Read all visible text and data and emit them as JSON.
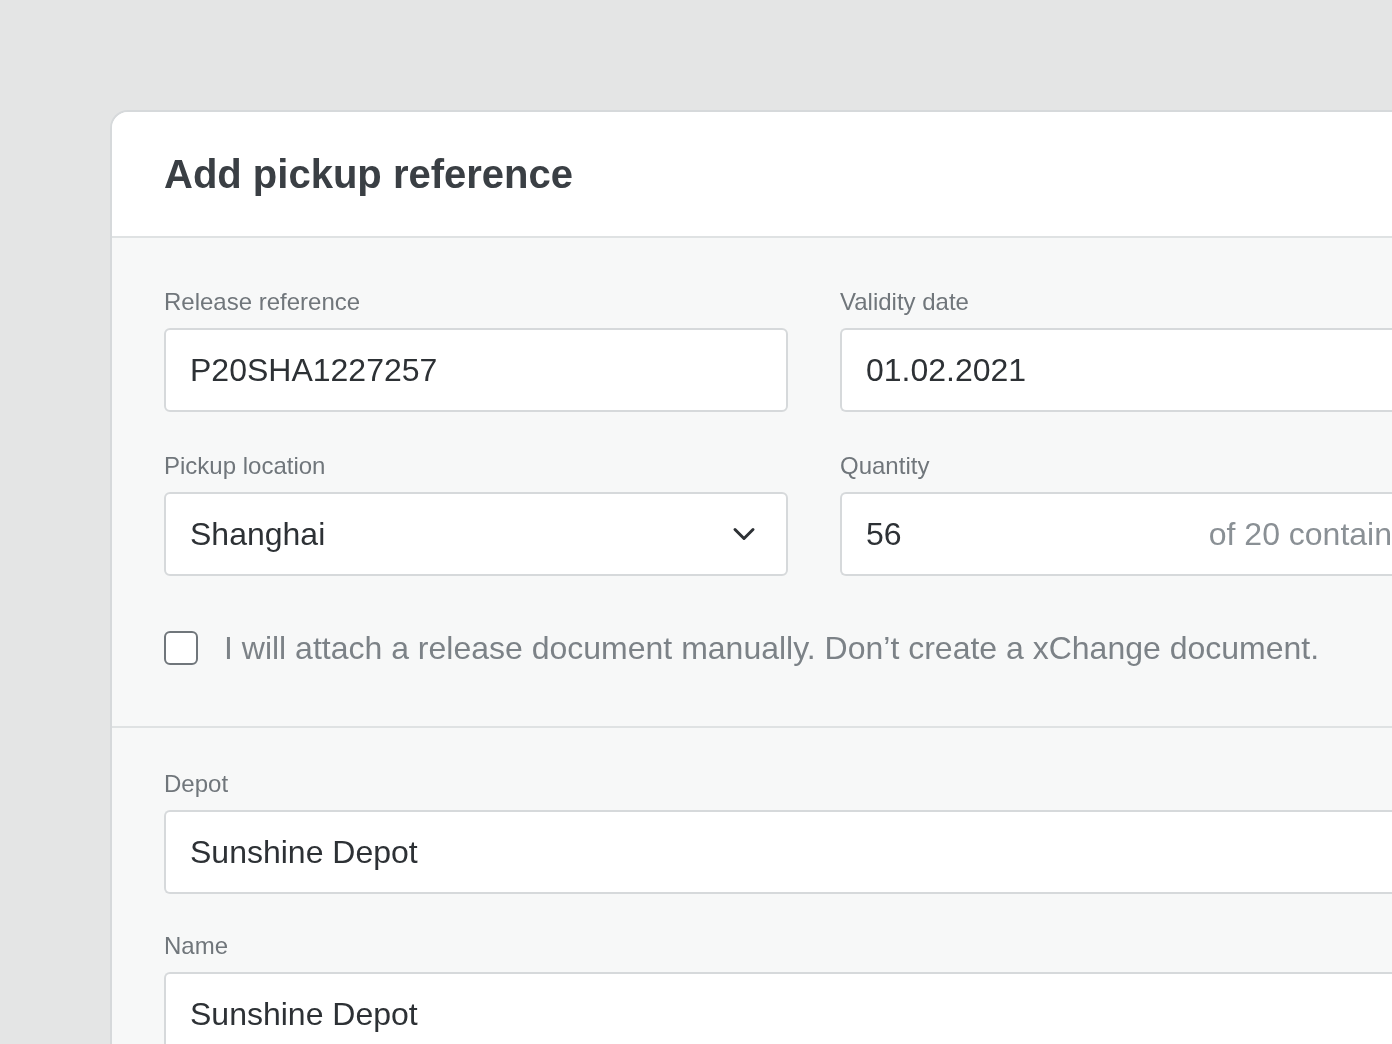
{
  "dialog": {
    "title": "Add pickup reference"
  },
  "fields": [
    {
      "kind": "text",
      "label": "Release reference",
      "value": "P20SHA1227257"
    },
    {
      "kind": "text",
      "label": "Validity date",
      "value": "01.02.2021"
    },
    {
      "kind": "select",
      "label": "Pickup location",
      "value": "Shanghai"
    },
    {
      "kind": "quantity",
      "label": "Quantity",
      "value": "56",
      "suffix": "of 20 contain"
    }
  ],
  "manual_checkbox": {
    "label": "I will attach a release document manually. Don’t create a xChange document.",
    "checked": false
  },
  "depot_fields": [
    {
      "label": "Depot",
      "value": "Sunshine Depot"
    },
    {
      "label": "Name",
      "value": "Sunshine Depot"
    }
  ]
}
